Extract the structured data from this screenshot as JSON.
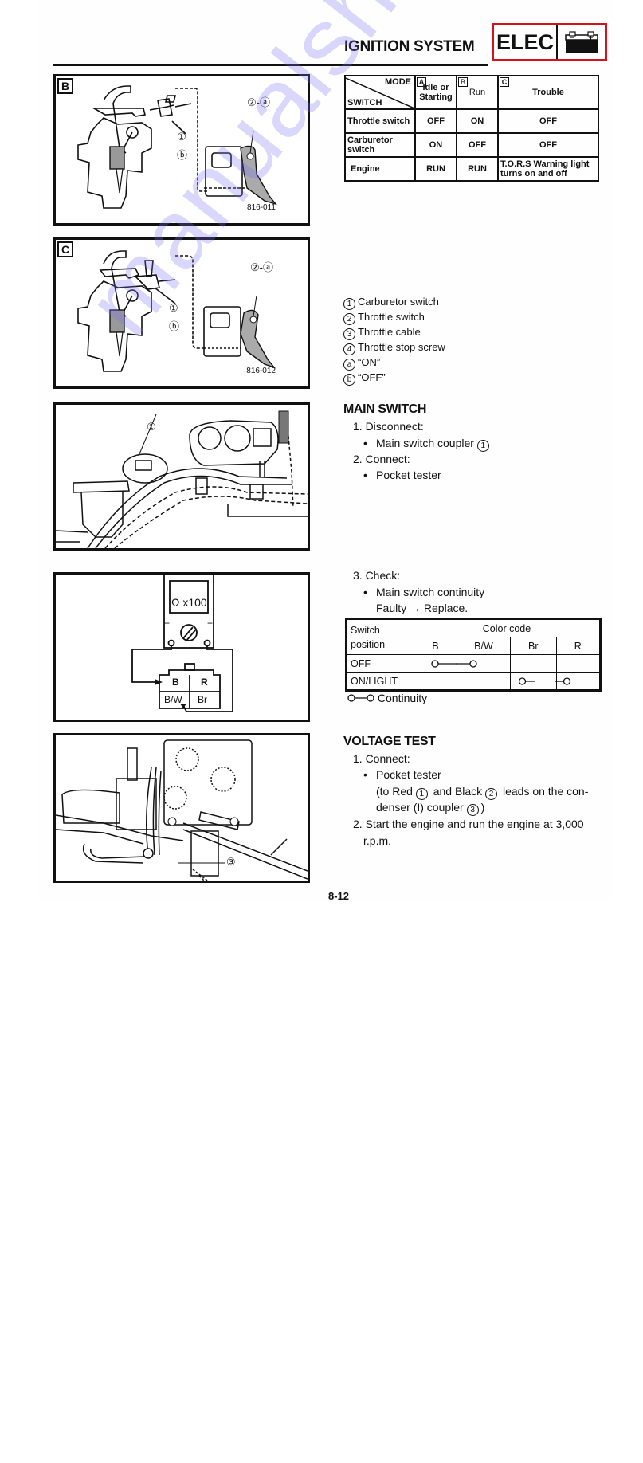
{
  "header": {
    "section_title": "IGNITION SYSTEM",
    "badge_label": "ELEC",
    "badge_icon": "battery-icon",
    "badge_border_color": "#d4121b"
  },
  "figures": [
    {
      "letter": "B",
      "code": "816-011",
      "callouts": [
        "②-ⓐ",
        "①",
        "ⓑ"
      ]
    },
    {
      "letter": "C",
      "code": "816-012",
      "callouts": [
        "②-ⓐ",
        "①",
        "ⓑ"
      ]
    },
    {
      "letter": "",
      "code": "",
      "callouts": [
        "①"
      ]
    },
    {
      "letter": "",
      "code": "",
      "meter_range": "Ω x100",
      "minus": "−",
      "plus": "+",
      "coupler_pins": [
        "B",
        "R",
        "B/W",
        "Br"
      ]
    },
    {
      "letter": "",
      "code": "",
      "callouts": [
        "③"
      ]
    }
  ],
  "mode_table": {
    "corner_top": "MODE",
    "corner_bottom": "SWITCH",
    "columns": [
      {
        "letter": "A",
        "label": "Idle or Starting"
      },
      {
        "letter": "B",
        "label": "Run"
      },
      {
        "letter": "C",
        "label": "Trouble"
      }
    ],
    "rows": [
      {
        "label": "Throttle switch",
        "values": [
          "OFF",
          "ON",
          "OFF"
        ]
      },
      {
        "label": "Carburetor switch",
        "values": [
          "ON",
          "OFF",
          "OFF"
        ]
      },
      {
        "label": "Engine",
        "values": [
          "RUN",
          "RUN",
          "T.O.R.S Warning light turns on and off"
        ]
      }
    ]
  },
  "legend": [
    {
      "mark": "1",
      "text": "Carburetor switch"
    },
    {
      "mark": "2",
      "text": "Throttle switch"
    },
    {
      "mark": "3",
      "text": "Throttle cable"
    },
    {
      "mark": "4",
      "text": "Throttle stop screw"
    },
    {
      "mark": "a",
      "text": "“ON”"
    },
    {
      "mark": "b",
      "text": "“OFF”"
    }
  ],
  "main_switch": {
    "title": "MAIN SWITCH",
    "step1": "1. Disconnect:",
    "step1_item": "Main switch coupler",
    "step1_mark": "1",
    "step2": "2. Connect:",
    "step2_item": "Pocket tester",
    "step3": "3. Check:",
    "step3_item": "Main switch continuity",
    "step3_note": "Faulty → Replace."
  },
  "continuity_table": {
    "row_header": "Switch position",
    "group_header": "Color code",
    "columns": [
      "B",
      "B/W",
      "Br",
      "R"
    ],
    "rows": [
      {
        "label": "OFF",
        "connected": [
          "B",
          "B/W"
        ]
      },
      {
        "label": "ON/LIGHT",
        "connected": [
          "Br",
          "R"
        ]
      }
    ],
    "legend": "Continuity"
  },
  "voltage_test": {
    "title": "VOLTAGE TEST",
    "step1": "1. Connect:",
    "step1_item": "Pocket tester",
    "step1_detail_a": "(to Red",
    "mark1": "1",
    "step1_detail_b": "and Black",
    "mark2": "2",
    "step1_detail_c": "leads on the con-",
    "step1_detail_d": "denser (I) coupler",
    "mark3": "3",
    "step1_detail_e": ")",
    "step2": "2. Start the engine and run the engine at 3,000",
    "step2_cont": "r.p.m."
  },
  "page_number": "8-12",
  "watermark": "manualshive.com"
}
